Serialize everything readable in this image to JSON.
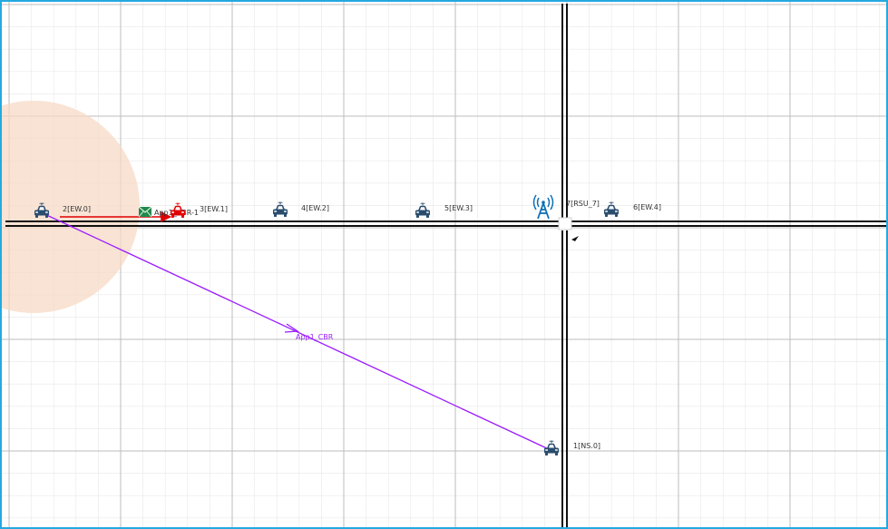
{
  "colors": {
    "frame_border": "#24a9e0",
    "grid_major": "#bdbdbd",
    "grid_minor": "#e8e8e8",
    "road": "#111111",
    "coverage": "#f7d9c6",
    "link": "#9b1bff",
    "packet_line": "#e00000",
    "vehicle": "#2a4d6e",
    "vehicle_active": "#e00000",
    "rsu": "#0d6fb8"
  },
  "nodes": [
    {
      "id": "node-2",
      "label": "2[EW.0]",
      "type": "vehicle",
      "icon": "car-icon"
    },
    {
      "id": "node-3",
      "label": "3[EW.1]",
      "type": "vehicle",
      "icon": "car-icon",
      "state": "active"
    },
    {
      "id": "node-4",
      "label": "4[EW.2]",
      "type": "vehicle",
      "icon": "car-icon"
    },
    {
      "id": "node-5",
      "label": "5[EW.3]",
      "type": "vehicle",
      "icon": "car-icon"
    },
    {
      "id": "node-7",
      "label": "7[RSU_7]",
      "type": "rsu",
      "icon": "antenna-tower-icon"
    },
    {
      "id": "node-6",
      "label": "6[EW.4]",
      "type": "vehicle",
      "icon": "car-icon"
    },
    {
      "id": "node-1",
      "label": "1[NS.0]",
      "type": "vehicle",
      "icon": "car-icon"
    }
  ],
  "links": [
    {
      "from": "node-2",
      "to": "node-1",
      "label": "App1_CBR"
    }
  ],
  "packet": {
    "label": "App1_CBR-1",
    "icon": "envelope-icon",
    "from": "node-2",
    "to": "node-3"
  }
}
